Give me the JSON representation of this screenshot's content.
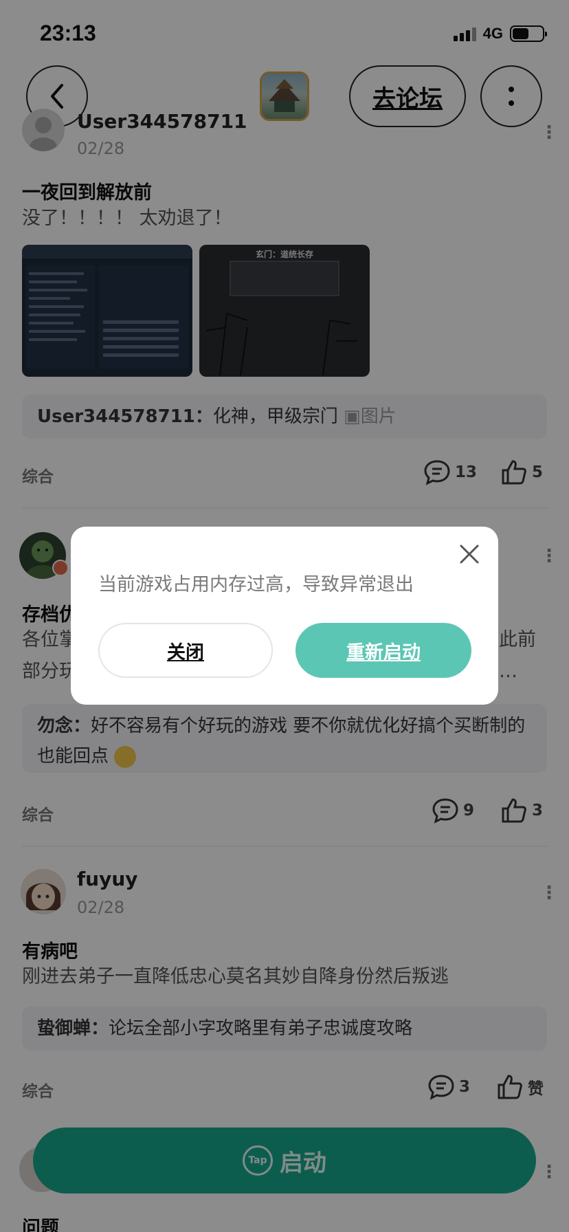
{
  "status_bar": {
    "time": "23:13",
    "network": "4G"
  },
  "header": {
    "forum_button": "去论坛"
  },
  "posts": [
    {
      "username": "User344578711",
      "date": "02/28",
      "title": "一夜回到解放前",
      "body": "没了！！！！  太劝退了！",
      "images": [
        {
          "caption": ""
        },
        {
          "caption": "玄门：道统长存"
        }
      ],
      "reply": {
        "author": "User344578711：",
        "text": "化神，甲级宗门",
        "attachment": "图片"
      },
      "tag": "综合",
      "comments": "13",
      "likes": "5"
    },
    {
      "username": "",
      "date": "",
      "title": "存档优",
      "body_line1_left": "各位掌",
      "body_line1_right": "此前",
      "body_line2_left": "部分玩",
      "body_line2_right": "…",
      "reply": {
        "author": "勿念：",
        "text": "好不容易有个好玩的游戏 要不你就优化好搞个买断制的 也能回点"
      },
      "tag": "综合",
      "comments": "9",
      "likes": "3"
    },
    {
      "username": "fuyuy",
      "date": "02/28",
      "title": "有病吧",
      "body": "刚进去弟子一直降低忠心莫名其妙自降身份然后叛逃",
      "reply": {
        "author": "蛰御蝉：",
        "text": "论坛全部小字攻略里有弟子忠诚度攻略"
      },
      "tag": "综合",
      "comments": "3",
      "likes": "赞"
    },
    {
      "title": "问题"
    }
  ],
  "launch_bar": {
    "logo": "Tap",
    "label": "启动"
  },
  "dialog": {
    "message": "当前游戏占用内存过高，导致异常退出",
    "close_label": "关闭",
    "restart_label": "重新启动"
  }
}
